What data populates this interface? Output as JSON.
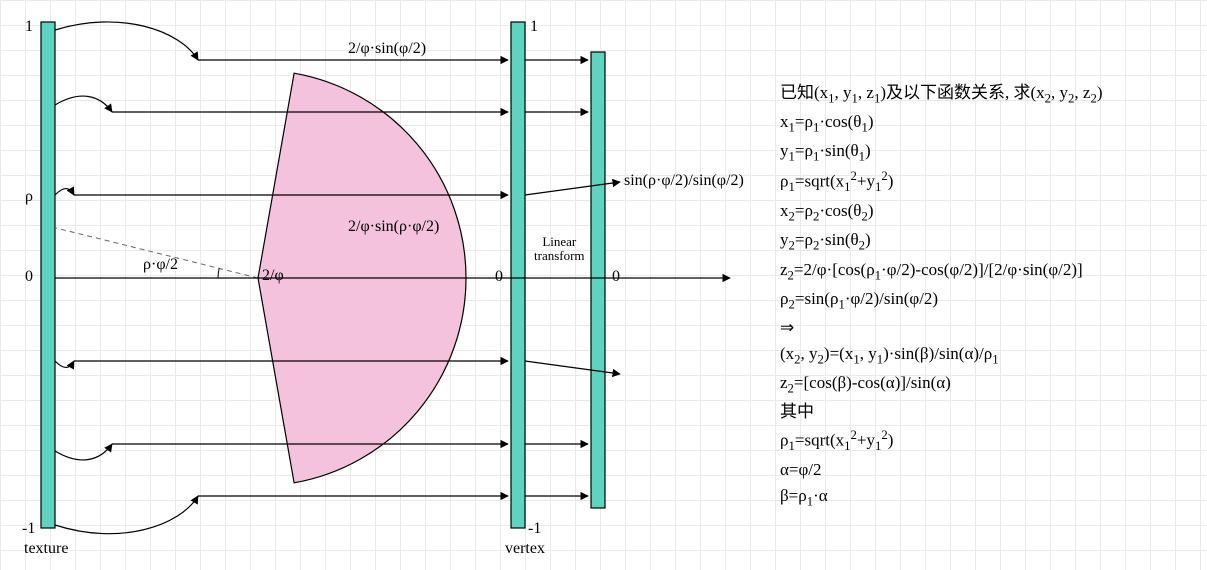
{
  "leftBar": {
    "top": "1",
    "zero": "0",
    "bottom": "-1",
    "rho": "ρ",
    "caption": "texture"
  },
  "midBar": {
    "top": "1",
    "zero": "0",
    "bottom": "-1",
    "caption": "vertex",
    "linear": "Linear\ntransform"
  },
  "rightBar": {
    "top": "",
    "zero": "0"
  },
  "sector": {
    "angleLabel": "ρ·φ/2",
    "radiusLabel": "2/φ"
  },
  "arrows": {
    "top": "2/φ·sin(φ/2)",
    "rho": "2/φ·sin(ρ·φ/2)",
    "rightResult": "sin(ρ·φ/2)/sin(φ/2)"
  },
  "equations": {
    "header_pre": "已知(x",
    "header_mid": ")及以下函数关系, 求(x",
    "header_end": ")",
    "l1": "x₁=ρ₁·cos(θ₁)",
    "l2": "y₁=ρ₁·sin(θ₁)",
    "l3": "ρ₁=sqrt(x₁²+y₁²)",
    "l4": "x₂=ρ₂·cos(θ₂)",
    "l5": "y₂=ρ₂·sin(θ₂)",
    "l6": "z₂=2/φ·[cos(ρ₁·φ/2)-cos(φ/2)]/[2/φ·sin(φ/2)]",
    "l7": "ρ₂=sin(ρ₁·φ/2)/sin(φ/2)",
    "l8": "⇒",
    "l9": "(x₂, y₂)=(x₁, y₁)·sin(β)/sin(α)/ρ₁",
    "l10": "z₂=[cos(β)-cos(α)]/sin(α)",
    "l11": "其中",
    "l12": "ρ₁=sqrt(x₁²+y₁²)",
    "l13": "α=φ/2",
    "l14": "β=ρ₁·α"
  }
}
